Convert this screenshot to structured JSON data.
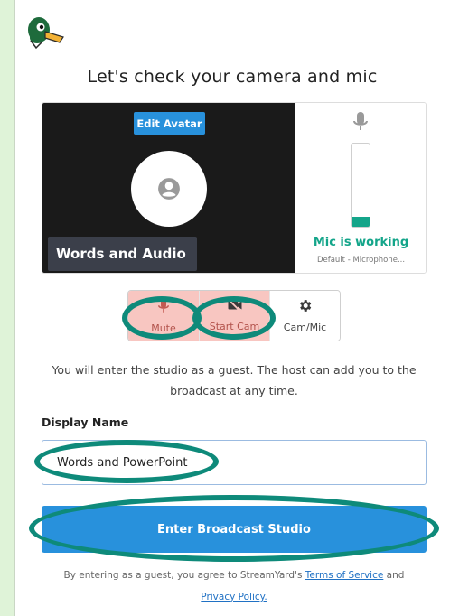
{
  "headline": "Let's check your camera and mic",
  "camera_preview": {
    "edit_avatar_label": "Edit Avatar",
    "name_tag": "Words and Audio"
  },
  "mic": {
    "status": "Mic is working",
    "device": "Default - Microphone...",
    "level_percent": 12,
    "icon": "microphone-icon"
  },
  "controls": [
    {
      "label": "Mute",
      "icon": "microphone-icon",
      "active": true
    },
    {
      "label": "Start Cam",
      "icon": "camera-off-icon",
      "active": true
    },
    {
      "label": "Cam/Mic",
      "icon": "gear-icon",
      "active": false
    }
  ],
  "guest_note": "You will enter the studio as a guest. The host can add you to the broadcast at any time.",
  "display_name": {
    "label": "Display Name",
    "value": "Words and PowerPoint"
  },
  "enter_button": "Enter Broadcast Studio",
  "terms": {
    "prefix": "By entering as a guest, you agree to StreamYard's",
    "tos_link": "Terms of Service",
    "and": "and",
    "privacy_link": "Privacy Policy."
  },
  "colors": {
    "accent": "#2891dc",
    "mic_ok": "#14a58a",
    "active_control": "#f8c6c1",
    "highlight": "#0e8a7a"
  }
}
